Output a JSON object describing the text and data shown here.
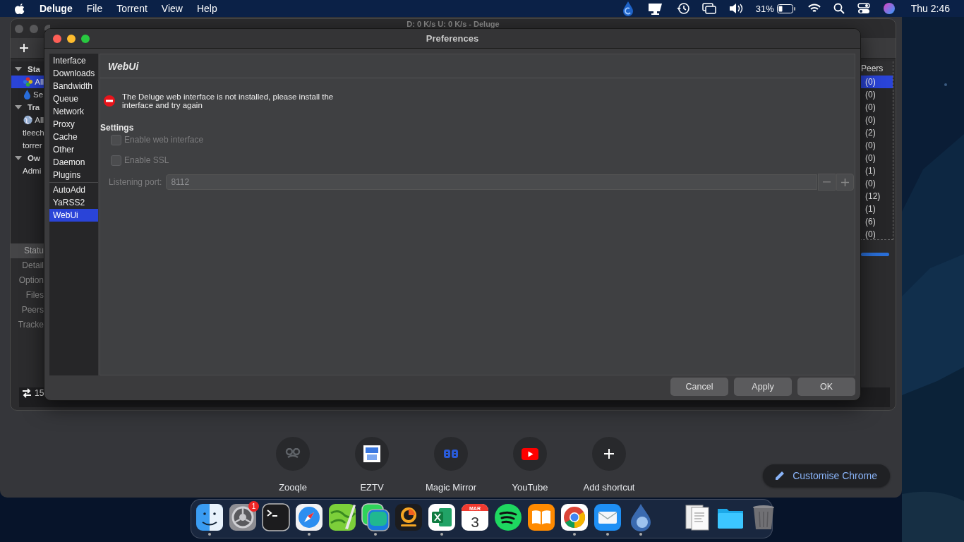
{
  "menu_bar": {
    "app": "Deluge",
    "menus": [
      "File",
      "Torrent",
      "View",
      "Help"
    ],
    "status_icons": [
      {
        "kind": "drop"
      },
      {
        "kind": "display"
      },
      {
        "kind": "history"
      },
      {
        "kind": "windows"
      },
      {
        "kind": "volume"
      }
    ],
    "battery_percent": "31%",
    "clock": "Thu 2:46"
  },
  "chrome_window": {
    "shortcuts": [
      {
        "label": "Zooqle",
        "kind": "zooqle"
      },
      {
        "label": "EZTV",
        "kind": "eztv"
      },
      {
        "label": "Magic Mirror",
        "kind": "mirror"
      },
      {
        "label": "YouTube",
        "kind": "youtube"
      },
      {
        "label": "Add shortcut",
        "kind": "add"
      }
    ],
    "customise_button": "Customise Chrome"
  },
  "deluge_window": {
    "title": "D: 0 K/s U: 0 K/s - Deluge",
    "sidebar": [
      {
        "label": "Sta",
        "expanded": true,
        "children": [
          {
            "label": "All",
            "kind": "all",
            "selected": true
          },
          {
            "label": "Se",
            "kind": "seeding",
            "selected": false
          }
        ]
      },
      {
        "label": "Tra",
        "expanded": true,
        "children": [
          {
            "label": "All",
            "kind": "globe",
            "selected": false
          },
          {
            "label": "tleech",
            "selected": false
          },
          {
            "label": "torrer",
            "selected": false
          }
        ]
      },
      {
        "label": "Ow",
        "expanded": true,
        "children": [
          {
            "label": "Admi",
            "selected": false
          }
        ]
      }
    ],
    "torrent_table": {
      "column": "Peers",
      "rows": [
        {
          "peers": "(0)",
          "selected": true
        },
        {
          "peers": "(0)",
          "selected": false
        },
        {
          "peers": "(0)",
          "selected": false
        },
        {
          "peers": "(0)",
          "selected": false
        },
        {
          "peers": "(2)",
          "selected": false
        },
        {
          "peers": "(0)",
          "selected": false
        },
        {
          "peers": "(0)",
          "selected": false
        },
        {
          "peers": "(1)",
          "selected": false
        },
        {
          "peers": "(0)",
          "selected": false
        },
        {
          "peers": "(12)",
          "selected": false
        },
        {
          "peers": "(1)",
          "selected": false
        },
        {
          "peers": "(6)",
          "selected": false
        },
        {
          "peers": "(0)",
          "selected": false
        }
      ]
    },
    "detail_tabs": [
      {
        "label": "Statu",
        "selected": true
      },
      {
        "label": "Detail",
        "selected": false
      },
      {
        "label": "Option",
        "selected": false
      },
      {
        "label": "Files",
        "selected": false
      },
      {
        "label": "Peers",
        "selected": false
      },
      {
        "label": "Tracke",
        "selected": false
      }
    ],
    "progress": {
      "level": 1
    },
    "status_bar": {
      "connections": "15"
    }
  },
  "preferences": {
    "title": "Preferences",
    "category_groups": [
      {
        "items": [
          {
            "label": "Interface",
            "selected": false
          },
          {
            "label": "Downloads",
            "selected": false
          },
          {
            "label": "Bandwidth",
            "selected": false
          },
          {
            "label": "Queue",
            "selected": false
          },
          {
            "label": "Network",
            "selected": false
          },
          {
            "label": "Proxy",
            "selected": false
          },
          {
            "label": "Cache",
            "selected": false
          },
          {
            "label": "Other",
            "selected": false
          },
          {
            "label": "Daemon",
            "selected": false
          },
          {
            "label": "Plugins",
            "selected": false
          }
        ]
      },
      {
        "items": [
          {
            "label": "AutoAdd",
            "selected": false
          },
          {
            "label": "YaRSS2",
            "selected": false
          },
          {
            "label": "WebUi",
            "selected": true
          }
        ]
      }
    ],
    "page": {
      "heading": "WebUi",
      "error": "The Deluge web interface is not installed, please install the interface and try again",
      "section": "Settings",
      "options": [
        {
          "label": "Enable web interface",
          "checked": false,
          "disabled": true
        },
        {
          "label": "Enable SSL",
          "checked": false,
          "disabled": true
        }
      ],
      "port": {
        "label": "Listening port:",
        "value": "8112",
        "disabled": true
      }
    },
    "buttons": [
      "Cancel",
      "Apply",
      "OK"
    ]
  },
  "dock": {
    "items": [
      {
        "kind": "finder",
        "running": true
      },
      {
        "kind": "settings",
        "running": false,
        "badge": "1"
      },
      {
        "kind": "terminal",
        "running": false
      },
      {
        "kind": "safari",
        "running": true
      },
      {
        "kind": "maps",
        "running": false
      },
      {
        "kind": "facetime",
        "running": true
      },
      {
        "kind": "bitcoin",
        "running": false
      },
      {
        "kind": "excel",
        "running": true
      },
      {
        "kind": "calendar",
        "running": false,
        "month": "MAR",
        "day": "3"
      },
      {
        "kind": "spotify",
        "running": false
      },
      {
        "kind": "books",
        "running": false
      },
      {
        "kind": "chrome",
        "running": true
      },
      {
        "kind": "mail",
        "running": true
      },
      {
        "kind": "deluge",
        "running": true
      },
      {
        "kind": "separator"
      },
      {
        "kind": "documents",
        "running": false
      },
      {
        "kind": "folder",
        "running": false
      },
      {
        "kind": "trash",
        "running": false
      }
    ]
  }
}
